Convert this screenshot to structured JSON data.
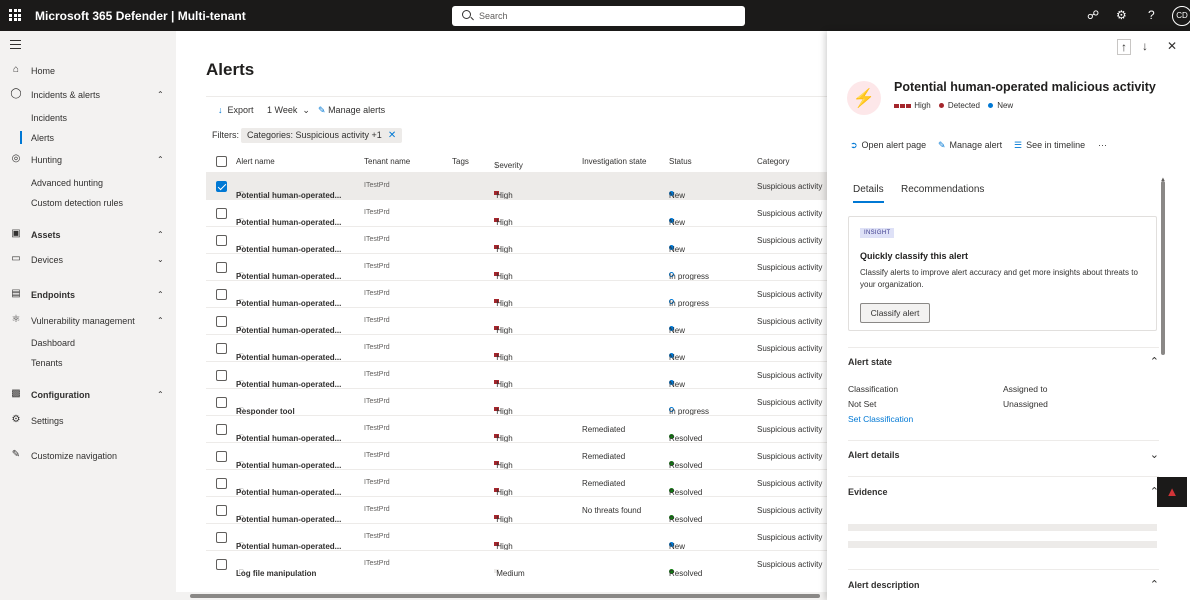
{
  "topbar": {
    "app_title": "Microsoft 365 Defender | Multi-tenant",
    "search_placeholder": "Search",
    "avatar_initials": "CD",
    "icons": [
      "waffle-icon",
      "share-icon",
      "settings-icon",
      "help-icon"
    ]
  },
  "sidebar": {
    "items": [
      {
        "label": "Home",
        "icon": "home-icon"
      },
      {
        "label": "Incidents & alerts",
        "icon": "shield-icon",
        "chevron": "up"
      },
      {
        "label": "Incidents"
      },
      {
        "label": "Alerts",
        "active": true
      },
      {
        "label": "Hunting",
        "icon": "hunting-icon",
        "chevron": "up"
      },
      {
        "label": "Advanced hunting"
      },
      {
        "label": "Custom detection rules"
      },
      {
        "label": "Assets",
        "icon": "assets-icon",
        "chevron": "up"
      },
      {
        "label": "Devices",
        "icon": "device-icon",
        "chevron": "down"
      },
      {
        "label": "Endpoints",
        "icon": "endpoints-icon",
        "chevron": "up"
      },
      {
        "label": "Vulnerability management",
        "icon": "vulnerability-icon",
        "chevron": "up"
      },
      {
        "label": "Dashboard"
      },
      {
        "label": "Tenants"
      },
      {
        "label": "Configuration",
        "icon": "configuration-icon",
        "chevron": "up"
      },
      {
        "label": "Settings",
        "icon": "gear-icon"
      },
      {
        "label": "Customize navigation",
        "icon": "edit-icon"
      }
    ]
  },
  "main": {
    "title": "Alerts",
    "toolbar": {
      "export": "Export",
      "range": "1 Week",
      "manage": "Manage alerts"
    },
    "filters_label": "Filters:",
    "filter_chip": "Categories: Suspicious activity +1",
    "columns": [
      "Alert name",
      "Tenant name",
      "Tags",
      "Severity",
      "Investigation state",
      "Status",
      "Category"
    ],
    "rows": [
      {
        "name": "Potential human-operated...",
        "tenant": "ITestPrd",
        "severity": "High",
        "inv": "",
        "status": "New",
        "category": "Suspicious activity",
        "selected": true
      },
      {
        "name": "Potential human-operated...",
        "tenant": "ITestPrd",
        "severity": "High",
        "inv": "",
        "status": "New",
        "category": "Suspicious activity"
      },
      {
        "name": "Potential human-operated...",
        "tenant": "ITestPrd",
        "severity": "High",
        "inv": "",
        "status": "New",
        "category": "Suspicious activity"
      },
      {
        "name": "Potential human-operated...",
        "tenant": "ITestPrd",
        "severity": "High",
        "inv": "",
        "status": "In progress",
        "category": "Suspicious activity"
      },
      {
        "name": "Potential human-operated...",
        "tenant": "ITestPrd",
        "severity": "High",
        "inv": "",
        "status": "In progress",
        "category": "Suspicious activity"
      },
      {
        "name": "Potential human-operated...",
        "tenant": "ITestPrd",
        "severity": "High",
        "inv": "",
        "status": "New",
        "category": "Suspicious activity"
      },
      {
        "name": "Potential human-operated...",
        "tenant": "ITestPrd",
        "severity": "High",
        "inv": "",
        "status": "New",
        "category": "Suspicious activity"
      },
      {
        "name": "Potential human-operated...",
        "tenant": "ITestPrd",
        "severity": "High",
        "inv": "",
        "status": "New",
        "category": "Suspicious activity"
      },
      {
        "name": "Responder tool",
        "tenant": "ITestPrd",
        "severity": "High",
        "inv": "",
        "status": "In progress",
        "category": "Suspicious activity"
      },
      {
        "name": "Potential human-operated...",
        "tenant": "ITestPrd",
        "severity": "High",
        "inv": "Remediated",
        "status": "Resolved",
        "category": "Suspicious activity"
      },
      {
        "name": "Potential human-operated...",
        "tenant": "ITestPrd",
        "severity": "High",
        "inv": "Remediated",
        "status": "Resolved",
        "category": "Suspicious activity"
      },
      {
        "name": "Potential human-operated...",
        "tenant": "ITestPrd",
        "severity": "High",
        "inv": "Remediated",
        "status": "Resolved",
        "category": "Suspicious activity"
      },
      {
        "name": "Potential human-operated...",
        "tenant": "ITestPrd",
        "severity": "High",
        "inv": "No threats found",
        "status": "Resolved",
        "category": "Suspicious activity"
      },
      {
        "name": "Potential human-operated...",
        "tenant": "ITestPrd",
        "severity": "High",
        "inv": "",
        "status": "New",
        "category": "Suspicious activity"
      },
      {
        "name": "Log file manipulation",
        "tenant": "ITestPrd",
        "severity": "Medium",
        "inv": "",
        "status": "Resolved",
        "category": "Suspicious activity"
      }
    ]
  },
  "panel": {
    "title": "Potential human-operated malicious activity",
    "severity": "High",
    "detection": "Detected",
    "status": "New",
    "actions": {
      "open": "Open alert page",
      "manage": "Manage alert",
      "timeline": "See in timeline",
      "more": "···"
    },
    "tabs": {
      "details": "Details",
      "recommendations": "Recommendations"
    },
    "insight": {
      "badge": "INSIGHT",
      "heading": "Quickly classify this alert",
      "text": "Classify alerts to improve alert accuracy and get more insights about threats to your organization.",
      "button": "Classify alert"
    },
    "alert_state": {
      "heading": "Alert state",
      "classification_label": "Classification",
      "classification_value": "Not Set",
      "set_link": "Set Classification",
      "assigned_label": "Assigned to",
      "assigned_value": "Unassigned"
    },
    "alert_details": "Alert details",
    "evidence": "Evidence",
    "alert_description": "Alert description"
  },
  "colors": {
    "accent": "#0078d4",
    "severity_high": "#a4262c",
    "resolved": "#107c10",
    "topbar": "#1b1a19"
  }
}
